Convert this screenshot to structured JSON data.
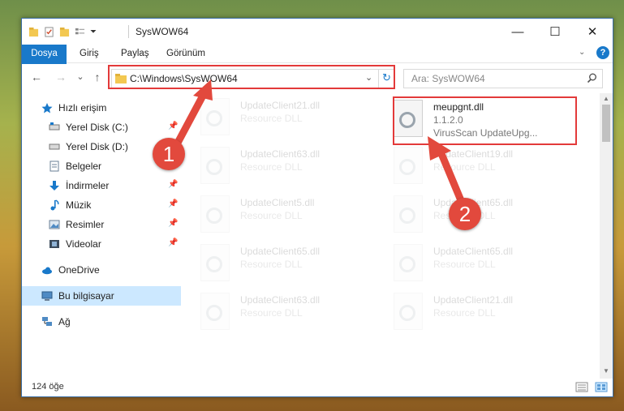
{
  "window": {
    "title": "SysWOW64",
    "controls": {
      "minimize": "—",
      "maximize": "☐",
      "close": "✕"
    }
  },
  "ribbon": {
    "tabs": [
      "Dosya",
      "Giriş",
      "Paylaş",
      "Görünüm"
    ],
    "help_icon": "?"
  },
  "navigation": {
    "back": "←",
    "forward": "→",
    "recent": "⌄",
    "up": "↑",
    "address": "C:\\Windows\\SysWOW64",
    "refresh": "↻",
    "search_placeholder": "Ara: SysWOW64"
  },
  "sidebar": {
    "items": [
      {
        "label": "Hızlı erişim",
        "icon": "star-icon",
        "pinned": false
      },
      {
        "label": "Yerel Disk (C:)",
        "icon": "drive-icon",
        "pinned": true
      },
      {
        "label": "Yerel Disk (D:)",
        "icon": "drive-icon",
        "pinned": true
      },
      {
        "label": "Belgeler",
        "icon": "documents-icon",
        "pinned": true
      },
      {
        "label": "İndirmeler",
        "icon": "download-icon",
        "pinned": true
      },
      {
        "label": "Müzik",
        "icon": "music-icon",
        "pinned": true
      },
      {
        "label": "Resimler",
        "icon": "pictures-icon",
        "pinned": true
      },
      {
        "label": "Videolar",
        "icon": "videos-icon",
        "pinned": true
      },
      {
        "label": "OneDrive",
        "icon": "cloud-icon",
        "pinned": false
      },
      {
        "label": "Bu bilgisayar",
        "icon": "computer-icon",
        "pinned": false
      },
      {
        "label": "Ağ",
        "icon": "network-icon",
        "pinned": false
      }
    ],
    "pin_glyph": "📌"
  },
  "files": {
    "left": [
      {
        "name": "UpdateClient21.dll",
        "type": "Resource DLL"
      },
      {
        "name": "UpdateClient63.dll",
        "type": "Resource DLL"
      },
      {
        "name": "UpdateClient5.dll",
        "type": "Resource DLL"
      },
      {
        "name": "UpdateClient65.dll",
        "type": "Resource DLL"
      },
      {
        "name": "UpdateClient63.dll",
        "type": "Resource DLL"
      }
    ],
    "right_highlight": {
      "name": "meupgnt.dll",
      "version": "1.1.2.0",
      "description": "VirusScan UpdateUpg..."
    },
    "right": [
      {
        "name": "UpdateClient19.dll",
        "type": "Resource DLL"
      },
      {
        "name": "UpdateClient65.dll",
        "type": "Resource DLL"
      },
      {
        "name": "UpdateClient65.dll",
        "type": "Resource DLL"
      },
      {
        "name": "UpdateClient21.dll",
        "type": "Resource DLL"
      }
    ]
  },
  "status": {
    "count": "124 öğe"
  },
  "annotations": {
    "step1": "1",
    "step2": "2",
    "color": "#e2493d"
  }
}
